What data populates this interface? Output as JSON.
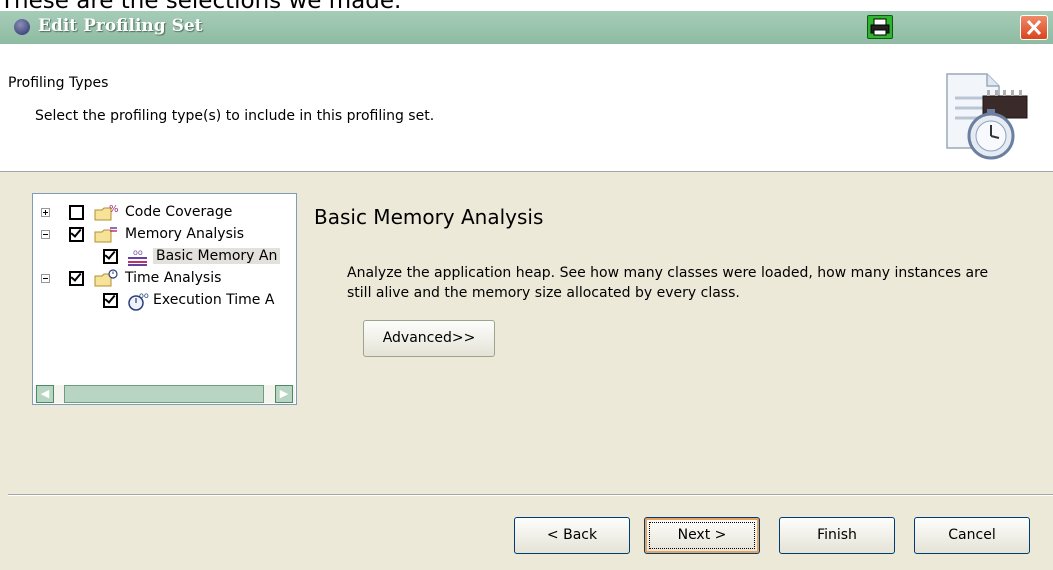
{
  "caption": "These are the selections we made.",
  "window": {
    "title": "Edit Profiling Set"
  },
  "header": {
    "title": "Profiling Types",
    "description": "Select the profiling type(s) to include in this profiling set."
  },
  "tree": {
    "items": [
      {
        "label": "Code Coverage",
        "checked": false,
        "expander": "plus",
        "icon": "folder-coverage-icon"
      },
      {
        "label": "Memory Analysis",
        "checked": true,
        "expander": "minus",
        "icon": "folder-memory-icon"
      },
      {
        "label": "Basic Memory An",
        "checked": true,
        "expander": null,
        "icon": "memory-analysis-icon",
        "selected": true
      },
      {
        "label": "Time Analysis",
        "checked": true,
        "expander": "minus",
        "icon": "folder-time-icon"
      },
      {
        "label": "Execution Time A",
        "checked": true,
        "expander": null,
        "icon": "execution-time-icon"
      }
    ]
  },
  "detail": {
    "title": "Basic Memory Analysis",
    "description": "Analyze the application heap. See how many classes were loaded, how many instances are still alive and the memory size allocated by every class.",
    "advanced_label": "Advanced>>"
  },
  "buttons": {
    "back": "< Back",
    "next": "Next >",
    "finish": "Finish",
    "cancel": "Cancel"
  },
  "colors": {
    "titlebar": "#9fc6b0",
    "close": "#d9441e",
    "print": "#2fb52f",
    "selection": "#e3e1dc"
  }
}
